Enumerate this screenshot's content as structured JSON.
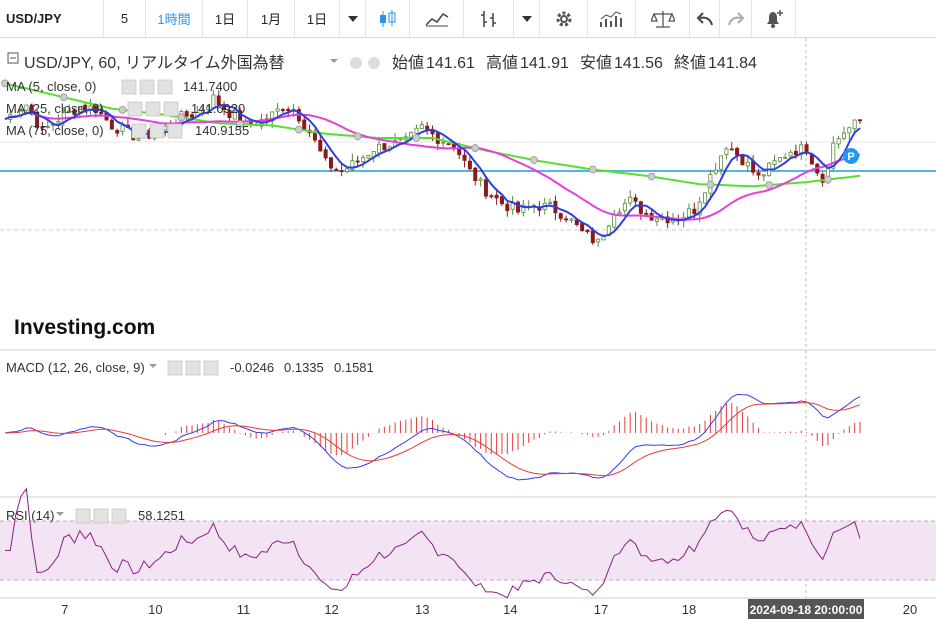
{
  "toolbar": {
    "symbol": "USD/JPY",
    "interval_value": "5",
    "intervals": [
      "1時間",
      "1日",
      "1月",
      "1日"
    ],
    "icons": [
      "candles-icon",
      "line-chart-icon",
      "bars-icon",
      "caret-down-icon",
      "gear-icon",
      "indicators-icon",
      "scale-icon",
      "undo-icon",
      "redo-icon",
      "alert-bell-icon"
    ]
  },
  "colors": {
    "up_candle": "#5a8a3c",
    "down_candle": "#8b1a1a",
    "ma5": "#2d3fe0",
    "ma25": "#e53fd8",
    "ma75": "#55e02f",
    "macd_line": "#3b3be8",
    "signal_line": "#e83b3b",
    "histogram": "#e53b3b",
    "rsi_line": "#8a1f8a",
    "rsi_band": "#f3e4f3",
    "hline": "#4fb8e6",
    "accent": "#2196f3"
  },
  "legend": {
    "title": "USD/JPY, 60, リアルタイム外国為替",
    "ohlc": [
      {
        "label": "始値",
        "value": "141.61"
      },
      {
        "label": "高値",
        "value": "141.91"
      },
      {
        "label": "安値",
        "value": "141.56"
      },
      {
        "label": "終値",
        "value": "141.84"
      }
    ],
    "ma": [
      {
        "label": "MA (5, close, 0)",
        "value": "141.7400",
        "color": "#2d3fe0"
      },
      {
        "label": "MA (25, close, 0)",
        "value": "141.6920",
        "color": "#e53fd8"
      },
      {
        "label": "MA (75, close, 0)",
        "value": "140.9155",
        "color": "#55e02f"
      }
    ],
    "macd": {
      "label": "MACD (12, 26, close, 9)",
      "values": [
        {
          "value": "-0.0246",
          "color": "#e53b3b"
        },
        {
          "value": "0.1335",
          "color": "#3b3be8"
        },
        {
          "value": "0.1581",
          "color": "#e53b3b"
        }
      ]
    },
    "rsi": {
      "label": "RSI (14)",
      "value": "58.1251"
    }
  },
  "logo": "Investing.com",
  "marker": "P",
  "crosshair_label": "2024-09-18 20:00:00",
  "chart_data": {
    "type": "candlestick",
    "x_ticks": [
      "7",
      "10",
      "11",
      "12",
      "13",
      "14",
      "17",
      "18",
      "20"
    ],
    "horizontal_line": 141.0,
    "ma_markers": true,
    "price_path": [
      [
        0,
        141.9
      ],
      [
        4,
        142.6
      ],
      [
        7,
        141.3
      ],
      [
        10,
        141.9
      ],
      [
        14,
        142.5
      ],
      [
        17,
        142.4
      ],
      [
        20,
        141.6
      ],
      [
        25,
        141.0
      ],
      [
        29,
        141.3
      ],
      [
        33,
        142.0
      ],
      [
        36,
        142.2
      ],
      [
        39,
        142.9
      ],
      [
        42,
        142.2
      ],
      [
        45,
        141.6
      ],
      [
        49,
        141.9
      ],
      [
        52,
        142.5
      ],
      [
        54,
        142.4
      ],
      [
        57,
        141.3
      ],
      [
        60,
        139.8
      ],
      [
        63,
        139.4
      ],
      [
        66,
        139.9
      ],
      [
        69,
        140.5
      ],
      [
        72,
        140.7
      ],
      [
        75,
        140.8
      ],
      [
        78,
        141.5
      ],
      [
        81,
        141.0
      ],
      [
        84,
        140.7
      ],
      [
        87,
        139.4
      ],
      [
        90,
        138.5
      ],
      [
        93,
        137.9
      ],
      [
        96,
        137.5
      ],
      [
        99,
        137.8
      ],
      [
        102,
        137.7
      ],
      [
        105,
        137.3
      ],
      [
        108,
        136.5
      ],
      [
        111,
        136.0
      ],
      [
        114,
        137.6
      ],
      [
        117,
        138.0
      ],
      [
        120,
        137.4
      ],
      [
        123,
        137.2
      ],
      [
        126,
        137.2
      ],
      [
        129,
        137.6
      ],
      [
        132,
        139.2
      ],
      [
        135,
        140.7
      ],
      [
        138,
        140.0
      ],
      [
        141,
        139.1
      ],
      [
        144,
        139.8
      ],
      [
        147,
        140.4
      ],
      [
        150,
        140.5
      ],
      [
        153,
        139.0
      ],
      [
        155,
        140.7
      ],
      [
        157,
        141.3
      ],
      [
        160,
        141.8
      ]
    ],
    "ma75_path": [
      [
        0,
        143.6
      ],
      [
        10,
        143.0
      ],
      [
        20,
        142.4
      ],
      [
        30,
        142.1
      ],
      [
        40,
        141.7
      ],
      [
        50,
        141.6
      ],
      [
        60,
        141.2
      ],
      [
        70,
        141.0
      ],
      [
        80,
        141.0
      ],
      [
        90,
        140.4
      ],
      [
        100,
        139.9
      ],
      [
        110,
        139.5
      ],
      [
        120,
        139.2
      ],
      [
        130,
        138.8
      ],
      [
        140,
        138.7
      ],
      [
        150,
        138.9
      ],
      [
        160,
        139.2
      ]
    ],
    "macd": {
      "zero": 0
    },
    "rsi": {
      "band": [
        30,
        70
      ],
      "last": 58.1251
    }
  }
}
